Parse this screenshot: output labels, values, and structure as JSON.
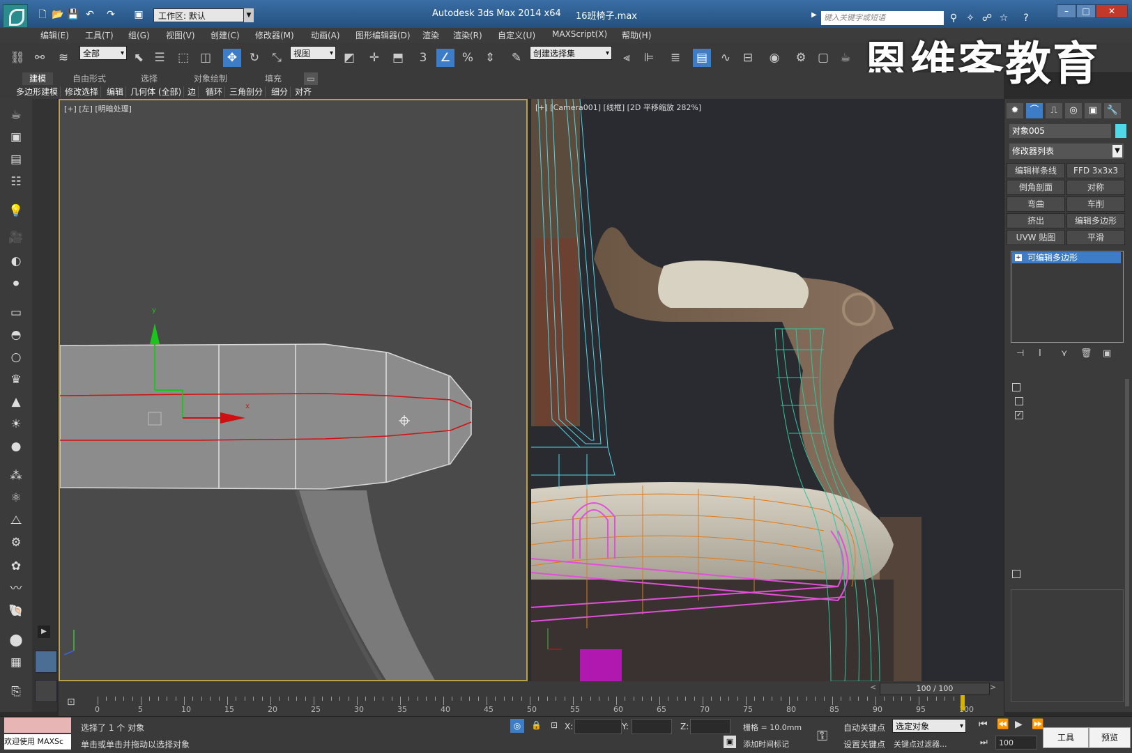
{
  "title_bar": {
    "workspace": "工作区: 默认",
    "app_title": "Autodesk 3ds Max  2014 x64",
    "file_name": "16班椅子.max",
    "search_placeholder": "键入关键字或短语"
  },
  "menu": [
    "编辑(E)",
    "工具(T)",
    "组(G)",
    "视图(V)",
    "创建(C)",
    "修改器(M)",
    "动画(A)",
    "图形编辑器(D)",
    "渲染",
    "渲染(R)",
    "自定义(U)",
    "MAXScript(X)",
    "帮助(H)"
  ],
  "toolbar": {
    "selection_filter": "全部",
    "ref_coord": "视图",
    "named_selection": "创建选择集",
    "snap_label": "3"
  },
  "watermark": "恩维客教育",
  "ribbon": {
    "tabs": [
      "建模",
      "自由形式",
      "选择",
      "对象绘制",
      "填充"
    ],
    "subtabs": [
      "多边形建模",
      "修改选择",
      "编辑",
      "几何体 (全部)",
      "边",
      "循环",
      "三角剖分",
      "细分",
      "对齐"
    ]
  },
  "viewport_left": {
    "label": "[+] [左] [明暗处理]",
    "gizmo_y": "y",
    "gizmo_x": "x"
  },
  "viewport_right": {
    "label": "[+] [Camera001] [线框] [2D 平移缩放 282%]"
  },
  "command_panel": {
    "object_name": "对象005",
    "modifier_list": "修改器列表",
    "modifier_buttons": [
      "编辑样条线",
      "FFD 3x3x3",
      "倒角剖面",
      "对称",
      "弯曲",
      "车削",
      "挤出",
      "编辑多边形",
      "UVW 贴图",
      "平滑"
    ],
    "stack_item": "可编辑多边形"
  },
  "timeline": {
    "frame_display": "100 / 100",
    "ticks": [
      "0",
      "5",
      "10",
      "15",
      "20",
      "25",
      "30",
      "35",
      "40",
      "45",
      "50",
      "55",
      "60",
      "65",
      "70",
      "75",
      "80",
      "85",
      "90",
      "95",
      "100"
    ]
  },
  "status": {
    "listener": "欢迎使用 MAXSc",
    "selection_msg": "选择了 1 个 对象",
    "prompt_msg": "单击或单击并拖动以选择对象",
    "x_label": "X:",
    "y_label": "Y:",
    "z_label": "Z:",
    "grid": "栅格 = 10.0mm",
    "auto_key": "自动关键点",
    "set_key": "设置关键点",
    "key_mode": "选定对象",
    "key_filters": "关键点过滤器...",
    "add_time_tag": "添加时间标记",
    "frame": "100",
    "tools": "工具",
    "preview": "预览"
  },
  "colors": {
    "accent": "#3d7dc7",
    "viewport_border": "#b8a14a",
    "wire_cyan": "#4fd8e8",
    "wire_magenta": "#e050d8",
    "wire_orange": "#e07a1a",
    "wire_green": "#2fc7a0",
    "edge_red": "#d01010"
  }
}
